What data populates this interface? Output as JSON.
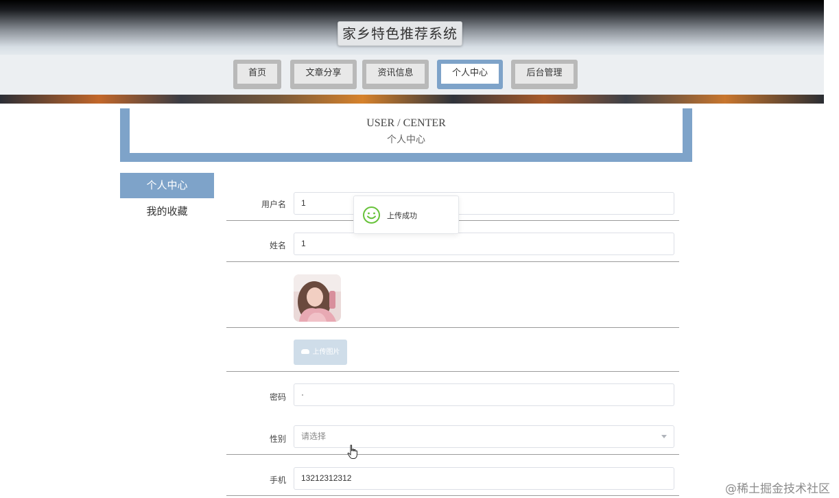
{
  "header": {
    "title": "家乡特色推荐系统"
  },
  "nav": {
    "items": [
      {
        "label": "首页"
      },
      {
        "label": "文章分享"
      },
      {
        "label": "资讯信息"
      },
      {
        "label": "个人中心"
      },
      {
        "label": "后台管理"
      }
    ],
    "active": "个人中心"
  },
  "page_heading": {
    "en": "USER / CENTER",
    "zh": "个人中心"
  },
  "sidebar": {
    "items": [
      {
        "label": "个人中心",
        "active": true
      },
      {
        "label": "我的收藏",
        "active": false
      }
    ]
  },
  "form": {
    "username": {
      "label": "用户名",
      "value": "1"
    },
    "name": {
      "label": "姓名",
      "value": "1"
    },
    "avatar": {
      "icon": "avatar-photo"
    },
    "upload": {
      "label": "上传图片",
      "icon": "cloud-upload-icon"
    },
    "password": {
      "label": "密码",
      "value": "·"
    },
    "gender": {
      "label": "性别",
      "value": "请选择"
    },
    "phone": {
      "label": "手机",
      "value": "13212312312"
    }
  },
  "toast": {
    "message": "上传成功",
    "icon": "smile-success-icon"
  },
  "watermark": "@稀土掘金技术社区",
  "colors": {
    "accent": "#7ea3c9",
    "success": "#67c23a",
    "nav_border": "#b9b9b9"
  }
}
